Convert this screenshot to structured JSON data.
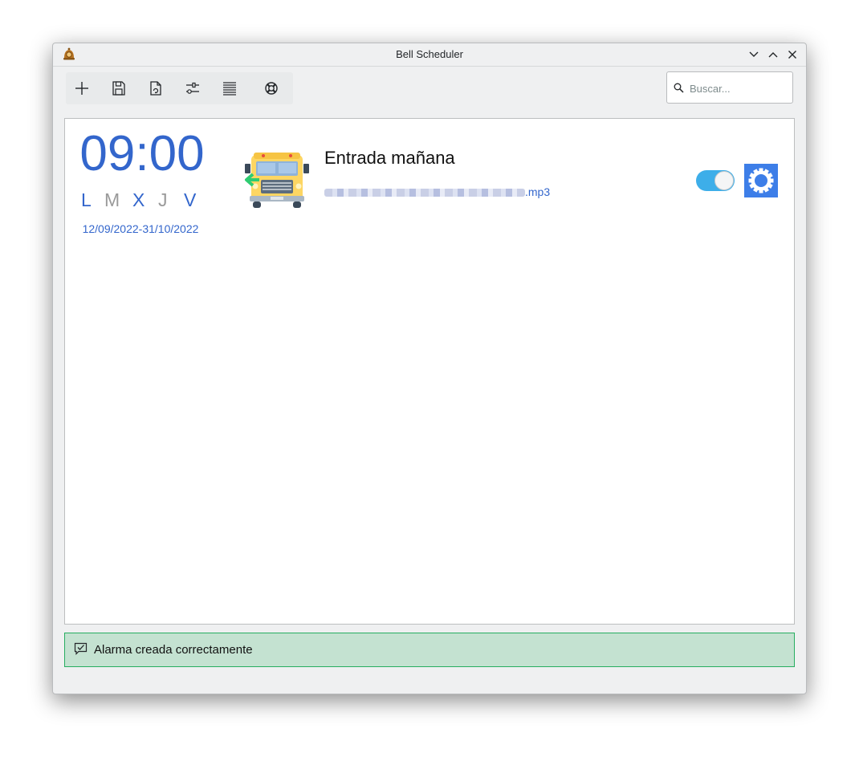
{
  "window": {
    "title": "Bell Scheduler"
  },
  "toolbar": {
    "icons": [
      "plus-icon",
      "save-icon",
      "load-file-icon",
      "preferences-icon",
      "list-icon",
      "help-icon"
    ]
  },
  "search": {
    "placeholder": "Buscar...",
    "value": ""
  },
  "alarm": {
    "time": "09:00",
    "days": [
      {
        "label": "L",
        "active": true
      },
      {
        "label": "M",
        "active": false
      },
      {
        "label": "X",
        "active": true
      },
      {
        "label": "J",
        "active": false
      },
      {
        "label": "V",
        "active": true
      }
    ],
    "date_range": "12/09/2022-31/10/2022",
    "name": "Entrada mañana",
    "file_suffix": ".mp3",
    "enabled": true
  },
  "status": {
    "message": "Alarma creada correctamente"
  },
  "colors": {
    "accent": "#3366cc",
    "toggle_on": "#3daee9",
    "settings_button": "#3d7ee8",
    "status_bg": "#c4e2d1",
    "status_border": "#27ae60"
  }
}
